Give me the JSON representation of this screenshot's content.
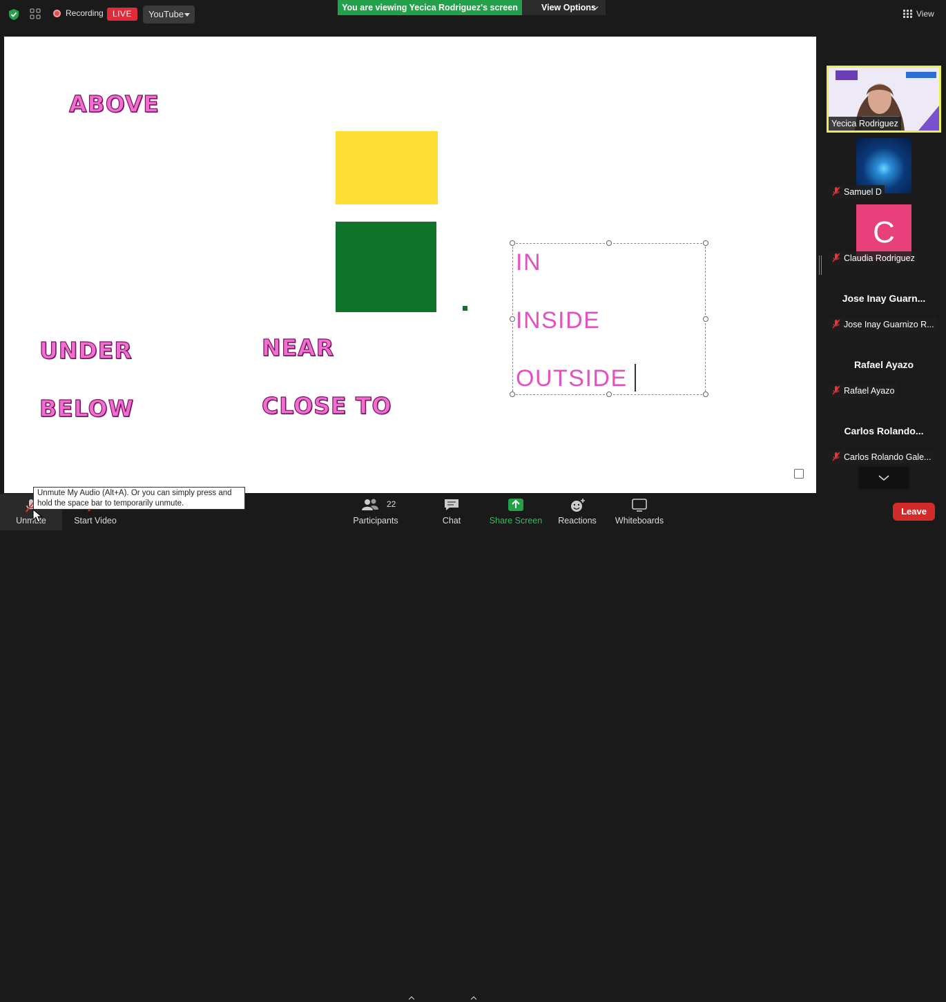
{
  "topbar": {
    "recording_label": "Recording",
    "live_label": "LIVE",
    "stream_target": "YouTube",
    "viewing_banner": "You are viewing Yecica Rodriguez's screen",
    "view_options_label": "View Options",
    "view_label": "View"
  },
  "shared_screen": {
    "words": {
      "above": "ABOVE",
      "under": "UNDER",
      "below": "BELOW",
      "near": "NEAR",
      "close_to": "CLOSE TO"
    },
    "textbox_lines": [
      "IN",
      "INSIDE",
      "OUTSIDE"
    ],
    "colors": {
      "yellow_box": "#fedd34",
      "green_box": "#0f732a",
      "word_fill": "#ee6fd0"
    }
  },
  "gallery": {
    "active_speaker": {
      "name": "Yecica Rodriguez"
    },
    "participants": [
      {
        "name": "Samuel D",
        "muted": true,
        "type": "video"
      },
      {
        "name": "Claudia Rodriguez",
        "muted": true,
        "type": "avatar",
        "initial": "C"
      },
      {
        "name": "Jose Inay Guarnizo R...",
        "display": "Jose Inay Guarn...",
        "muted": true,
        "type": "name"
      },
      {
        "name": "Rafael Ayazo",
        "display": "Rafael Ayazo",
        "muted": true,
        "type": "name"
      },
      {
        "name": "Carlos Rolando Gale...",
        "display": "Carlos  Rolando...",
        "muted": true,
        "type": "name"
      }
    ]
  },
  "toolbar": {
    "unmute_label": "Unmute",
    "start_video_label": "Start Video",
    "participants_label": "Participants",
    "participants_count": "22",
    "chat_label": "Chat",
    "share_screen_label": "Share Screen",
    "reactions_label": "Reactions",
    "whiteboards_label": "Whiteboards",
    "leave_label": "Leave",
    "tooltip": "Unmute My Audio (Alt+A). Or you can simply press and hold the space bar to temporarily unmute."
  }
}
